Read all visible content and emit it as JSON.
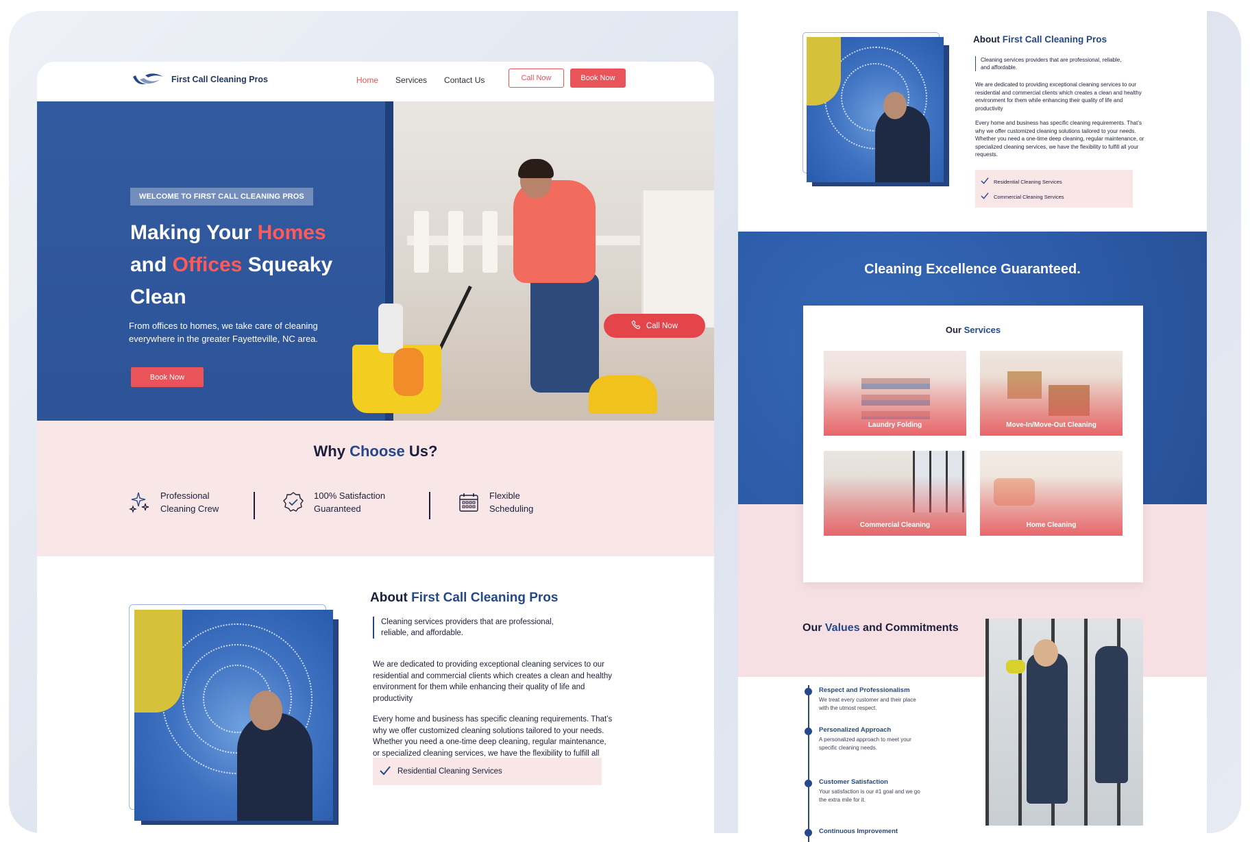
{
  "brand": {
    "name": "First Call Cleaning Pros"
  },
  "nav": {
    "links": [
      "Home",
      "Services",
      "Contact Us"
    ],
    "call_label": "Call Now",
    "book_label": "Book Now"
  },
  "hero": {
    "tag": "WELCOME TO FIRST CALL CLEANING PROS",
    "title_parts": [
      "Making Your ",
      "Homes",
      " and ",
      "Offices",
      " Squeaky Clean"
    ],
    "description": "From offices to homes, we take care of cleaning everywhere in the greater Fayetteville, NC area.",
    "book_label": "Book Now",
    "call_label": "Call Now"
  },
  "why": {
    "title_parts": [
      "Why ",
      "Choose",
      " Us?"
    ],
    "features": [
      {
        "line1": "Professional",
        "line2": "Cleaning Crew",
        "icon": "sparkles-icon"
      },
      {
        "line1": "100% Satisfaction",
        "line2": "Guaranteed",
        "icon": "badge-check-icon"
      },
      {
        "line1": "Flexible",
        "line2": "Scheduling",
        "icon": "calendar-icon"
      }
    ]
  },
  "about": {
    "title_parts": [
      "About ",
      "First Call Cleaning Pros"
    ],
    "quote": "Cleaning services providers that are professional, reliable, and affordable.",
    "p1": "We are dedicated to providing exceptional cleaning services to our residential and commercial clients which creates a clean and healthy environment for them while enhancing their quality of life and productivity",
    "p2": "Every home and business has specific cleaning requirements. That’s why we offer customized cleaning solutions tailored to your needs. Whether you need a one-time deep cleaning, regular maintenance, or specialized cleaning services, we have the flexibility to fulfill all your requests.",
    "checks": [
      "Residential Cleaning Services",
      "Commercial Cleaning Services"
    ]
  },
  "excellence": {
    "title": "Cleaning Excellence Guaranteed."
  },
  "services": {
    "title_parts": [
      "Our ",
      "Services"
    ],
    "items": [
      "Laundry Folding",
      "Move-In/Move-Out Cleaning",
      "Commercial Cleaning",
      "Home Cleaning"
    ]
  },
  "values": {
    "title_parts": [
      "Our ",
      "Values",
      " and Commitments"
    ],
    "items": [
      {
        "head": "Respect and Professionalism",
        "text": "We treat every customer and their place with the utmost respect."
      },
      {
        "head": "Personalized Approach",
        "text": "A personalized approach to meet your specific cleaning needs."
      },
      {
        "head": "Customer Satisfaction",
        "text": "Your satisfaction is our #1 goal and we go the extra mile for it."
      },
      {
        "head": "Continuous Improvement",
        "text": ""
      }
    ]
  },
  "colors": {
    "accent": "#e8545a",
    "brand_blue": "#25488a",
    "pink_bg": "#f9e6e7"
  }
}
